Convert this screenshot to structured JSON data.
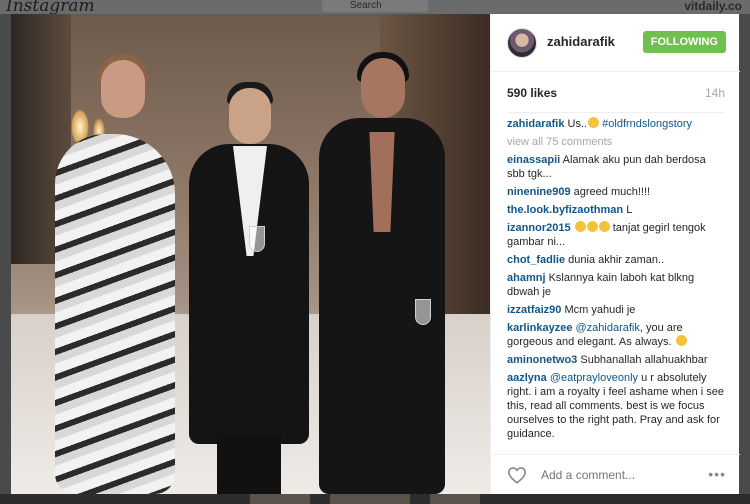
{
  "header": {
    "logo": "Instagram",
    "search_placeholder": "Search",
    "watermark": "vitdaily.co"
  },
  "post": {
    "username": "zahidarafik",
    "follow_label": "FOLLOWING",
    "likes": "590 likes",
    "time": "14h",
    "caption_user": "zahidarafik",
    "caption_text": "Us..",
    "caption_tag": "#oldfrndslongstory",
    "view_all": "view all 75 comments",
    "comments": [
      {
        "user": "einassapii",
        "text": "Alamak aku pun dah berdosa sbb tgk..."
      },
      {
        "user": "ninenine909",
        "text": "agreed much!!!!"
      },
      {
        "user": "the.look.byfizaothman",
        "text": "L"
      },
      {
        "user": "izannor2015",
        "text": "tanjat gegirl tengok gambar ni..."
      },
      {
        "user": "chot_fadlie",
        "text": "dunia akhir zaman.."
      },
      {
        "user": "ahamnj",
        "text": "Kslannya kain laboh kat blkng dbwah je"
      },
      {
        "user": "izzatfaiz90",
        "text": "Mcm yahudi je"
      },
      {
        "user": "karlinkayzee",
        "mention": "@zahidarafik",
        "text": ", you are gorgeous and elegant. As always."
      },
      {
        "user": "aminonetwo3",
        "text": "Subhanallah allahuakhbar"
      },
      {
        "user": "aazlyna",
        "mention": "@eatprayloveonly",
        "text": "u r absolutely right. i am a royalty i feel ashame when i see this, read all comments. best is we focus ourselves to the right path. Pray and ask for guidance."
      }
    ],
    "add_comment_placeholder": "Add a comment...",
    "more_label": "•••"
  },
  "colors": {
    "follow_bg": "#70c050",
    "username_link": "#125688",
    "muted": "#a5a7aa"
  },
  "icons": [
    "heart-icon",
    "more-options-icon",
    "search-icon",
    "emoji-icon"
  ]
}
